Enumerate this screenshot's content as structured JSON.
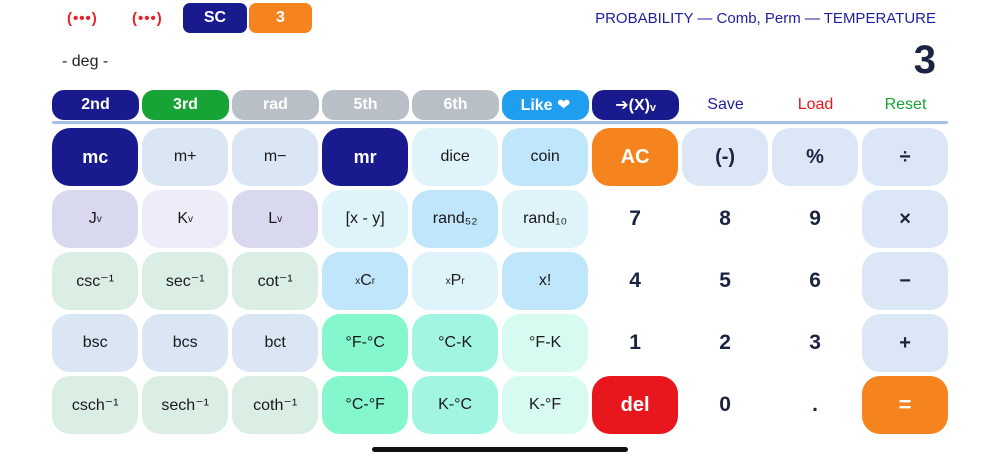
{
  "header": {
    "dots_left_1": "(•••)",
    "dots_left_2": "(•••)",
    "sc_label": "SC",
    "count_label": "3",
    "mode_title": "PROBABILITY — Comb, Perm — TEMPERATURE",
    "angle_mode": "- deg -",
    "display_value": "3"
  },
  "function_row": {
    "b2nd": "2nd",
    "b3rd": "3rd",
    "rad": "rad",
    "b5th": "5th",
    "b6th": "6th",
    "like": "Like ❤",
    "arrow_x": "➔(X)ᵥ",
    "save": "Save",
    "load": "Load",
    "reset": "Reset"
  },
  "keys": [
    [
      "mc",
      "m+",
      "m−",
      "mr",
      "dice",
      "coin",
      "AC",
      "(-)",
      "%",
      "÷"
    ],
    [
      "J",
      "K",
      "L",
      "[x - y]",
      "rand₅₂",
      "rand₁₀",
      "7",
      "8",
      "9",
      "×"
    ],
    [
      "csc⁻¹",
      "sec⁻¹",
      "cot⁻¹",
      "C",
      "P",
      "x!",
      "4",
      "5",
      "6",
      "−"
    ],
    [
      "bsc",
      "bcs",
      "bct",
      "°F-°C",
      "°C-K",
      "°F-K",
      "1",
      "2",
      "3",
      "+"
    ],
    [
      "csch⁻¹",
      "sech⁻¹",
      "coth⁻¹",
      "°C-°F",
      "K-°C",
      "K-°F",
      "del",
      "0",
      ".",
      "="
    ]
  ],
  "subscripts": {
    "v": "v",
    "x": "x",
    "r": "r"
  },
  "colors": {
    "navy": "#1a1a8f",
    "orange": "#f5841f",
    "green": "#17a336",
    "gray": "#b9bfc7",
    "cyan": "#1f9ef0",
    "red": "#e8161d",
    "memory": "#dae6f4",
    "jkl": "#d8d9ee",
    "inverse_trig": "#dbeee3",
    "probability": "#dff3fb",
    "probability_dark": "#bfe6fb",
    "temp_green": "#84f7cc",
    "temp_mint": "#a2f5e2",
    "temp_light": "#d8fbf1",
    "operator": "#dbe7f6"
  }
}
